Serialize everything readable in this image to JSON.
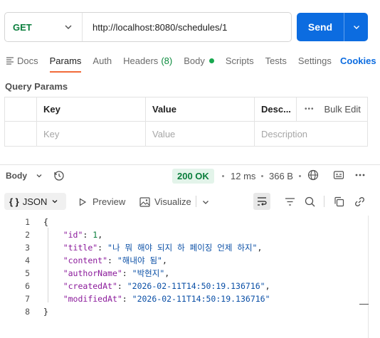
{
  "request": {
    "method": "GET",
    "url": "http://localhost:8080/schedules/1",
    "send_label": "Send"
  },
  "tabs": {
    "docs": "Docs",
    "params": "Params",
    "auth": "Auth",
    "headers": "Headers",
    "headers_count": "(8)",
    "body": "Body",
    "scripts": "Scripts",
    "tests": "Tests",
    "settings": "Settings",
    "cookies": "Cookies"
  },
  "query_params": {
    "title": "Query Params",
    "headers": {
      "key": "Key",
      "value": "Value",
      "description": "Desc...",
      "bulk_edit": "Bulk Edit"
    },
    "placeholders": {
      "key": "Key",
      "value": "Value",
      "description": "Description"
    }
  },
  "response": {
    "body_tab": "Body",
    "status": "200 OK",
    "time": "12 ms",
    "size": "366 B",
    "format": "JSON",
    "preview": "Preview",
    "visualize": "Visualize"
  },
  "code_lines": {
    "l1": {
      "num": "1",
      "text": "{"
    },
    "l2": {
      "num": "2",
      "key": "\"id\"",
      "colon": ": ",
      "value": "1",
      "tail": ","
    },
    "l3": {
      "num": "3",
      "key": "\"title\"",
      "colon": ": ",
      "value": "\"나 뭐 해야 되지 하 페이징 언제 하지\"",
      "tail": ","
    },
    "l4": {
      "num": "4",
      "key": "\"content\"",
      "colon": ": ",
      "value": "\"해내야 됨\"",
      "tail": ","
    },
    "l5": {
      "num": "5",
      "key": "\"authorName\"",
      "colon": ": ",
      "value": "\"박현지\"",
      "tail": ","
    },
    "l6": {
      "num": "6",
      "key": "\"createdAt\"",
      "colon": ": ",
      "value": "\"2026-02-11T14:50:19.136716\"",
      "tail": ","
    },
    "l7": {
      "num": "7",
      "key": "\"modifiedAt\"",
      "colon": ": ",
      "value": "\"2026-02-11T14:50:19.136716\"",
      "tail": ""
    },
    "l8": {
      "num": "8",
      "text": "}"
    }
  },
  "colors": {
    "accent": "#0c6ce0",
    "method_get": "#0a7e3c",
    "active_tab_underline": "#f26b3a",
    "status_ok_bg": "#e3f4ea",
    "status_ok_text": "#0a7e3c"
  },
  "icons": [
    "chevron-down-icon",
    "docs-icon",
    "history-icon",
    "globe-icon",
    "save-example-icon",
    "more-icon",
    "play-icon",
    "image-icon",
    "wrap-lines-icon",
    "filter-icon",
    "search-icon",
    "copy-icon",
    "link-icon"
  ]
}
